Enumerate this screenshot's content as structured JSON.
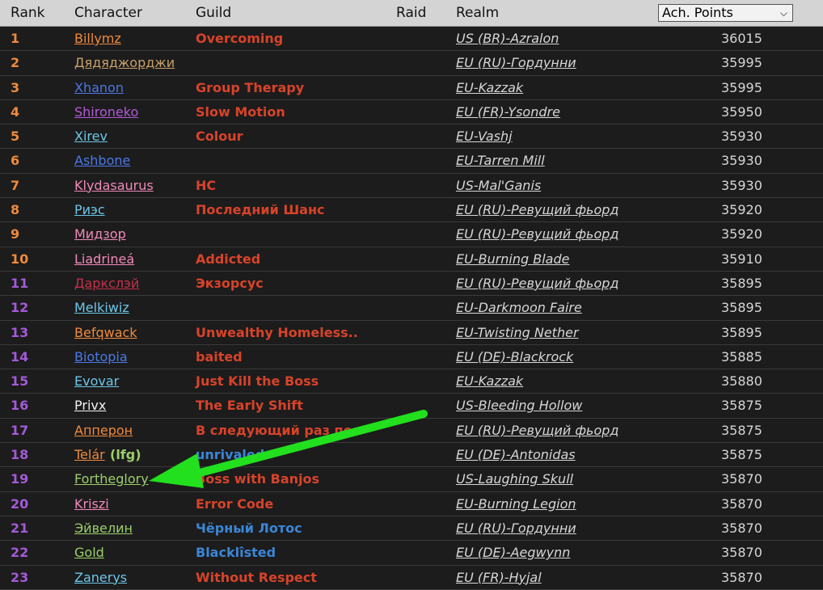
{
  "header": {
    "rank": "Rank",
    "character": "Character",
    "guild": "Guild",
    "raid": "Raid",
    "realm": "Realm",
    "sort_selected": "Ach. Points"
  },
  "rows": [
    {
      "rank": "1",
      "character": "Billymz",
      "char_color": "#f08a3c",
      "guild": "Overcoming",
      "guild_color": "#d8432a",
      "realm": "US (BR)-Azralon",
      "points": "36015",
      "rank_color": "#f08a3c"
    },
    {
      "rank": "2",
      "character": "Дядяджорджи",
      "char_color": "#c8a06a",
      "guild": "",
      "guild_color": "#d8432a",
      "realm": "EU (RU)-Гордунни",
      "points": "35995",
      "rank_color": "#f08a3c"
    },
    {
      "rank": "3",
      "character": "Xhanon",
      "char_color": "#4b78e6",
      "guild": "Group Therapy",
      "guild_color": "#d8432a",
      "realm": "EU-Kazzak",
      "points": "35995",
      "rank_color": "#f08a3c"
    },
    {
      "rank": "4",
      "character": "Shironeko",
      "char_color": "#b05ad6",
      "guild": "Slow Motion",
      "guild_color": "#d8432a",
      "realm": "EU (FR)-Ysondre",
      "points": "35950",
      "rank_color": "#f08a3c"
    },
    {
      "rank": "5",
      "character": "Xirev",
      "char_color": "#6cc6e8",
      "guild": "Colour",
      "guild_color": "#d8432a",
      "realm": "EU-Vashj",
      "points": "35930",
      "rank_color": "#f08a3c"
    },
    {
      "rank": "6",
      "character": "Ashbone",
      "char_color": "#4b78e6",
      "guild": "",
      "guild_color": "#d8432a",
      "realm": "EU-Tarren Mill",
      "points": "35930",
      "rank_color": "#f08a3c"
    },
    {
      "rank": "7",
      "character": "Klydasaurus",
      "char_color": "#f08ab8",
      "guild": "HC",
      "guild_color": "#d8432a",
      "realm": "US-Mal'Ganis",
      "points": "35930",
      "rank_color": "#f08a3c"
    },
    {
      "rank": "8",
      "character": "Риэс",
      "char_color": "#6cc6e8",
      "guild": "Последний Шанс",
      "guild_color": "#d8432a",
      "realm": "EU (RU)-Ревущий фьорд",
      "points": "35920",
      "rank_color": "#f08a3c"
    },
    {
      "rank": "9",
      "character": "Мидзор",
      "char_color": "#f08ab8",
      "guild": "",
      "guild_color": "#d8432a",
      "realm": "EU (RU)-Ревущий фьорд",
      "points": "35920",
      "rank_color": "#f08a3c"
    },
    {
      "rank": "10",
      "character": "Liadrineá",
      "char_color": "#f08ab8",
      "guild": "Addicted",
      "guild_color": "#d8432a",
      "realm": "EU-Burning Blade",
      "points": "35910",
      "rank_color": "#f08a3c"
    },
    {
      "rank": "11",
      "character": "Даркслэй",
      "char_color": "#c4304a",
      "guild": "Экзорсус",
      "guild_color": "#d8432a",
      "realm": "EU (RU)-Ревущий фьорд",
      "points": "35895",
      "rank_color": "#a35ad8"
    },
    {
      "rank": "12",
      "character": "Melkiwiz",
      "char_color": "#6cc6e8",
      "guild": "",
      "guild_color": "#d8432a",
      "realm": "EU-Darkmoon Faire",
      "points": "35895",
      "rank_color": "#a35ad8"
    },
    {
      "rank": "13",
      "character": "Befqwack",
      "char_color": "#f08a3c",
      "guild": "Unwealthy Homeless..",
      "guild_color": "#d8432a",
      "realm": "EU-Twisting Nether",
      "points": "35895",
      "rank_color": "#a35ad8"
    },
    {
      "rank": "14",
      "character": "Biotopia",
      "char_color": "#4b78e6",
      "guild": "baited",
      "guild_color": "#d8432a",
      "realm": "EU (DE)-Blackrock",
      "points": "35885",
      "rank_color": "#a35ad8"
    },
    {
      "rank": "15",
      "character": "Evovar",
      "char_color": "#6cc6e8",
      "guild": "Just Kill the Boss",
      "guild_color": "#d8432a",
      "realm": "EU-Kazzak",
      "points": "35880",
      "rank_color": "#a35ad8"
    },
    {
      "rank": "16",
      "character": "Privx",
      "char_color": "#f2f2f2",
      "guild": "The Early Shift",
      "guild_color": "#d8432a",
      "realm": "US-Bleeding Hollow",
      "points": "35875",
      "rank_color": "#a35ad8"
    },
    {
      "rank": "17",
      "character": "Апперон",
      "char_color": "#f08a3c",
      "guild": "В следующий раз по..",
      "guild_color": "#d8432a",
      "realm": "EU (RU)-Ревущий фьорд",
      "points": "35875",
      "rank_color": "#a35ad8"
    },
    {
      "rank": "18",
      "character": "Telár",
      "char_color": "#f08a3c",
      "lfg": "(lfg)",
      "guild": "unrivaled",
      "guild_color": "#3a86d6",
      "realm": "EU (DE)-Antonidas",
      "points": "35875",
      "rank_color": "#a35ad8"
    },
    {
      "rank": "19",
      "character": "Fortheglory",
      "char_color": "#9ccf6a",
      "guild": "Boss with Banjos",
      "guild_color": "#d8432a",
      "realm": "US-Laughing Skull",
      "points": "35870",
      "rank_color": "#a35ad8"
    },
    {
      "rank": "20",
      "character": "Kriszi",
      "char_color": "#f08ab8",
      "guild": "Error Code",
      "guild_color": "#d8432a",
      "realm": "EU-Burning Legion",
      "points": "35870",
      "rank_color": "#a35ad8"
    },
    {
      "rank": "21",
      "character": "Эйвелин",
      "char_color": "#9ccf6a",
      "guild": "Чёрный Лотос",
      "guild_color": "#3a86d6",
      "realm": "EU (RU)-Гордунни",
      "points": "35870",
      "rank_color": "#a35ad8"
    },
    {
      "rank": "22",
      "character": "Gold",
      "char_color": "#9ccf6a",
      "guild": "Blacklîsted",
      "guild_color": "#3a86d6",
      "realm": "EU (DE)-Aegwynn",
      "points": "35870",
      "rank_color": "#a35ad8"
    },
    {
      "rank": "23",
      "character": "Zanerys",
      "char_color": "#6cc6e8",
      "guild": "Without Respect",
      "guild_color": "#d8432a",
      "realm": "EU (FR)-Hyjal",
      "points": "35870",
      "rank_color": "#a35ad8"
    }
  ],
  "arrow_color": "#22e01e"
}
